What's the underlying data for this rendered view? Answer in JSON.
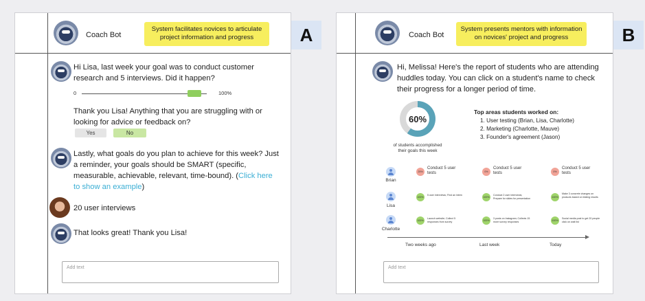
{
  "panel_a": {
    "letter": "A",
    "bot_name": "Coach Bot",
    "note": "System facilitates novices to articulate project information and progress",
    "msg1": "Hi Lisa, last week your goal was to conduct customer research and 5 interviews. Did it happen?",
    "slider": {
      "min_label": "0",
      "max_label": "100%",
      "value_percent": 90
    },
    "msg2": "Thank you Lisa! Anything that you are struggling with or looking for advice or feedback on?",
    "yes_label": "Yes",
    "no_label": "No",
    "msg3": "Lastly, what goals do you plan to achieve for this week? Just a reminder, your goals should be SMART (specific, measurable, achievable, relevant, time-bound). (",
    "msg3_link": "Click here to show an example",
    "msg3_end": ")",
    "user_reply": "20 user interviews",
    "msg4": "That looks great! Thank you Lisa!",
    "input_placeholder": "Add text"
  },
  "panel_b": {
    "letter": "B",
    "bot_name": "Coach Bot",
    "note": "System presents mentors with information on novices' project and progress",
    "msg1": "Hi, Melissa! Here's the report of students who are attending huddles today. You can click on a student's name to check their progress for a longer period of time.",
    "donut": {
      "label": "60%",
      "percent": 60,
      "color": "#5aa3b8",
      "rest_color": "#d9d9d9"
    },
    "donut_caption": "of students accomplished their goals this week",
    "areas_title": "Top areas students worked on:",
    "areas": [
      "1. User testing (Brian, Lisa, Charlotte)",
      "2. Marketing (Charlotte, Mauve)",
      "3. Founder's agreement (Jason)"
    ],
    "students": [
      {
        "name": "Brian",
        "cells": [
          {
            "badge": "25%",
            "color": "red",
            "text": "Conduct 5 user tests",
            "size": "normal"
          },
          {
            "badge": "0%",
            "color": "red",
            "text": "Conduct 5 user tests",
            "size": "normal"
          },
          {
            "badge": "0%",
            "color": "red",
            "text": "Conduct 5 user tests",
            "size": "normal"
          }
        ]
      },
      {
        "name": "Lisa",
        "cells": [
          {
            "badge": "100%",
            "color": "green",
            "text": "5 user interviews; Find an intern",
            "size": "small"
          },
          {
            "badge": "100%",
            "color": "green",
            "text": "Conduct 2 user interviews; Prepare for slides for presentation",
            "size": "small"
          },
          {
            "badge": "100%",
            "color": "green",
            "text": "Make 3 concrete changes on products based on testing results",
            "size": "small"
          }
        ]
      },
      {
        "name": "Charlotte",
        "cells": [
          {
            "badge": "100%",
            "color": "green",
            "text": "Launch website; Collect 5 responses from survey",
            "size": "small"
          },
          {
            "badge": "100%",
            "color": "green",
            "text": "3 posts on Instagram; Collects 15 more survey responses",
            "size": "small"
          },
          {
            "badge": "100%",
            "color": "green",
            "text": "Social media post to get 20 people click on wait list",
            "size": "small"
          }
        ]
      }
    ],
    "timeline": [
      "Two weeks ago",
      "Last week",
      "Today"
    ],
    "input_placeholder": "Add text"
  }
}
